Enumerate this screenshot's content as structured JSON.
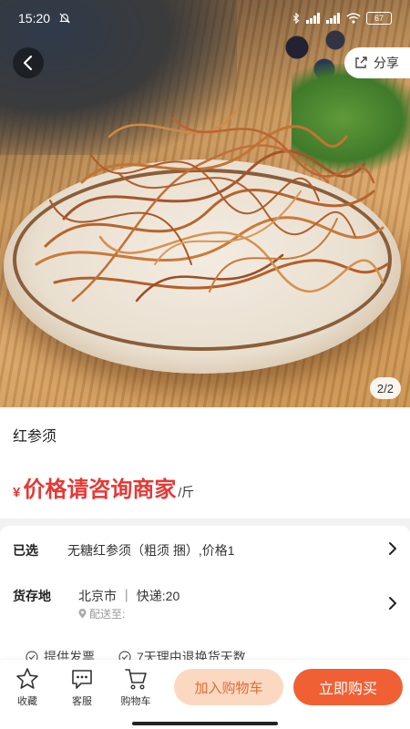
{
  "status_bar": {
    "time": "15:20",
    "battery": "67",
    "icons": [
      "silent-bell-icon",
      "bluetooth-icon",
      "signal-icon",
      "signal-icon",
      "wifi-icon",
      "battery-icon"
    ]
  },
  "gallery": {
    "page_indicator": "2/2",
    "share_label": "分享"
  },
  "product": {
    "name": "红参须",
    "price_symbol": "¥",
    "price_text": "价格请咨询商家",
    "price_unit": "/斤"
  },
  "options": {
    "selected_label": "已选",
    "selected_value": "无糖红参须（粗须 捆）,价格1",
    "location_label": "货存地",
    "location_value": "北京市 ｜ 快递:20",
    "ship_to_label": "配送至:"
  },
  "services": [
    "提供发票",
    "7天理由退换货天数"
  ],
  "bottom_bar": {
    "favorite_label": "收藏",
    "service_label": "客服",
    "cart_label": "购物车",
    "add_to_cart_label": "加入购物车",
    "buy_now_label": "立即购买"
  },
  "colors": {
    "price_red": "#e53935",
    "buy_orange": "#f06034",
    "cart_peach": "#fbd9c1"
  }
}
